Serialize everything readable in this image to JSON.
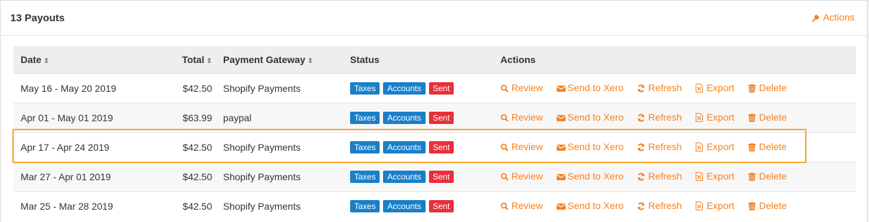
{
  "panel": {
    "title": "13 Payouts",
    "actions_label": "Actions"
  },
  "colors": {
    "accent": "#f58220",
    "badge_blue": "#1a7fc9",
    "badge_red": "#e7303b",
    "highlight": "#f2a530"
  },
  "table": {
    "columns": [
      "Date",
      "Total",
      "Payment Gateway",
      "Status",
      "Actions"
    ],
    "action_labels": {
      "review": "Review",
      "send": "Send to Xero",
      "refresh": "Refresh",
      "export": "Export",
      "delete": "Delete"
    },
    "badges": {
      "taxes": "Taxes",
      "accounts": "Accounts",
      "sent": "Sent"
    },
    "rows": [
      {
        "date": "May 16 - May 20 2019",
        "total": "$42.50",
        "gateway": "Shopify Payments"
      },
      {
        "date": "Apr 01 - May 01 2019",
        "total": "$63.99",
        "gateway": "paypal"
      },
      {
        "date": "Apr 17 - Apr 24 2019",
        "total": "$42.50",
        "gateway": "Shopify Payments"
      },
      {
        "date": "Mar 27 - Apr 01 2019",
        "total": "$42.50",
        "gateway": "Shopify Payments"
      },
      {
        "date": "Mar 25 - Mar 28 2019",
        "total": "$42.50",
        "gateway": "Shopify Payments"
      }
    ]
  }
}
